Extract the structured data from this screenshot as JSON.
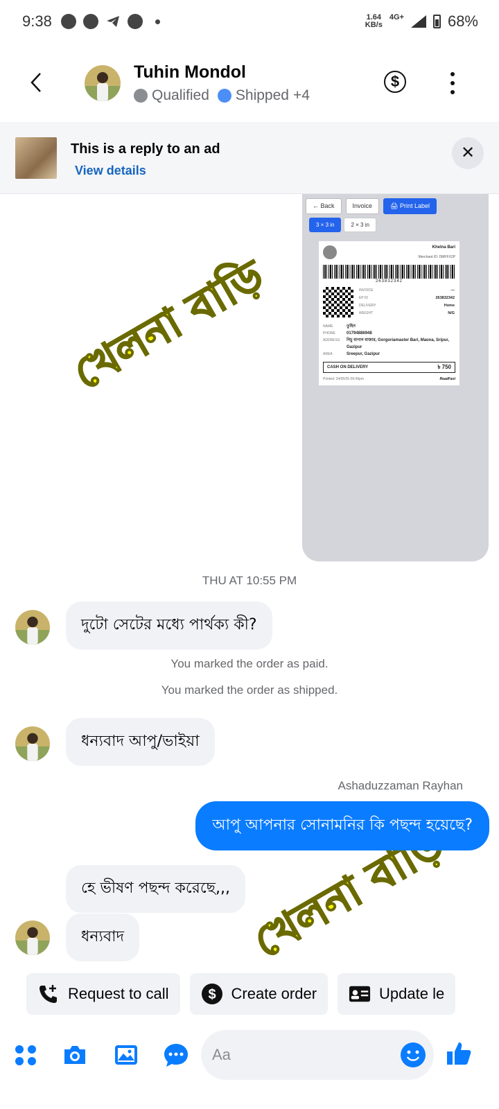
{
  "status_bar": {
    "time": "9:38",
    "speed": "1.64\nKB/s",
    "network": "4G+",
    "battery": "68%"
  },
  "header": {
    "contact_name": "Tuhin Mondol",
    "tag1": "Qualified",
    "tag2": "Shipped",
    "tag_more": "+4",
    "colors": {
      "qualified_dot": "#8a8d91",
      "shipped_dot": "#4c8ef7"
    }
  },
  "ad_banner": {
    "title": "This is a reply to an ad",
    "link": "View details"
  },
  "shared_image": {
    "buttons": {
      "back": "← Back",
      "invoice": "Invoice",
      "print": "🖨 Print Label"
    },
    "sizes": {
      "size1": "3 × 3 in",
      "size2": "2 × 3 in"
    },
    "label": {
      "shop": "Khelna Bari",
      "merchant": "Merchant ID: DMFFX2P",
      "barcode_number": "263832342",
      "meta": [
        {
          "key": "INVOICE",
          "value": "—"
        },
        {
          "key": "EP ID",
          "value": "263832342"
        },
        {
          "key": "DELIVERY",
          "value": "Home"
        },
        {
          "key": "WEIGHT",
          "value": "N/G"
        }
      ],
      "address": [
        {
          "key": "NAME",
          "value": "তুহিন"
        },
        {
          "key": "PHONE",
          "value": "01794886948"
        },
        {
          "key": "ADDRESS",
          "value": "নিচু বাগান বাজার, Gorgoriamaster Bari, Maona, Sripur, Gazipur"
        },
        {
          "key": "AREA",
          "value": "Sreepur, Gazipur"
        }
      ],
      "cod_label": "CASH ON DELIVERY",
      "cod_amount": "৳ 750",
      "printed": "Printed: 24/05/26 09:49pm",
      "brand": "ReadFast"
    }
  },
  "watermark": "খেলনা বাড়ি",
  "chat": {
    "time_separator": "THU AT 10:55 PM",
    "msg1": "দুটো সেটের মধ্যে পার্থক্য কী?",
    "sys1": "You marked the order as paid.",
    "sys2": "You marked the order as shipped.",
    "msg2": "ধন্যবাদ আপু/ভাইয়া",
    "sender": "Ashaduzzaman Rayhan",
    "msg3": "আপু আপনার সোনামনির কি পছন্দ হয়েছে?",
    "msg4": "হে ভীষণ পছন্দ করেছে,,,",
    "msg5": "ধন্যবাদ",
    "colors": {
      "outgoing_bubble": "#0a7cff",
      "incoming_bubble": "#f0f2f5"
    }
  },
  "quick_actions": {
    "request_call": "Request to call",
    "create_order": "Create order",
    "update_lead": "Update le"
  },
  "composer": {
    "placeholder": "Aa",
    "icons": [
      "apps-icon",
      "camera-icon",
      "gallery-icon",
      "saved-reply-icon",
      "emoji-icon",
      "like-icon"
    ]
  }
}
